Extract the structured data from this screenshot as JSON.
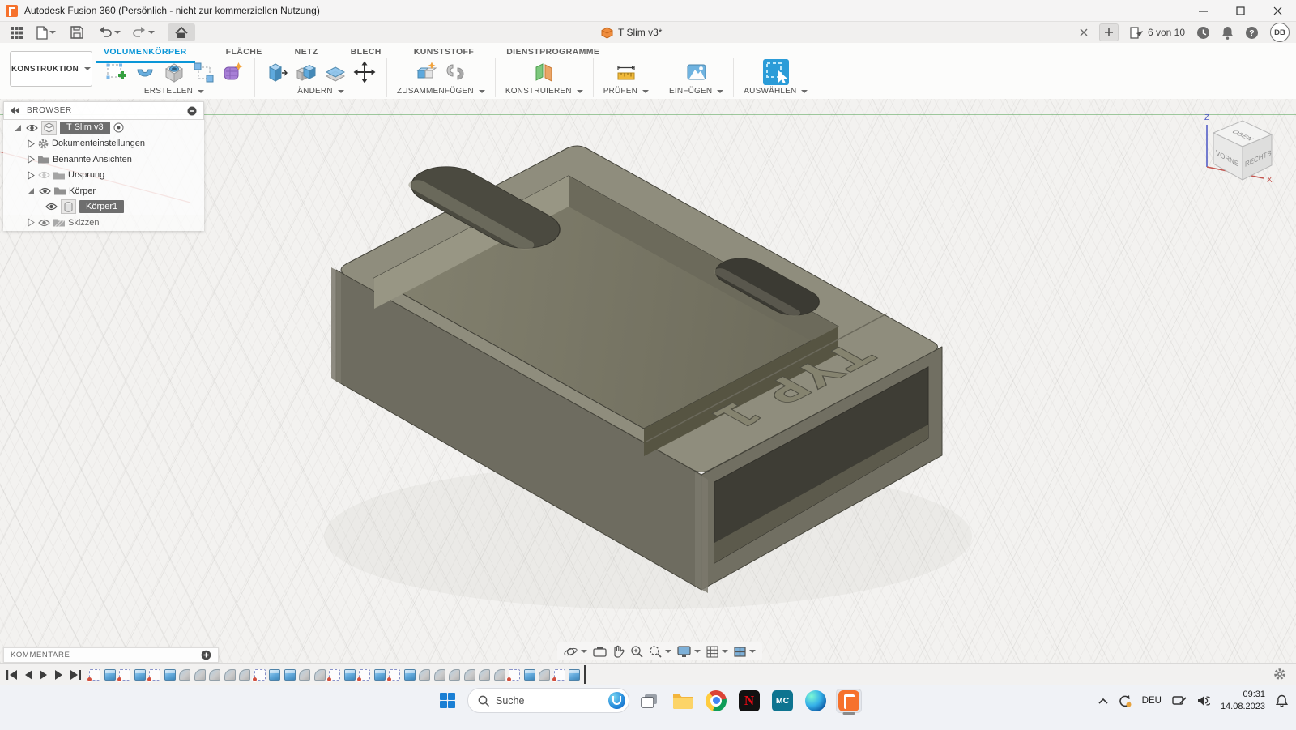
{
  "titlebar": {
    "title": "Autodesk Fusion 360 (Persönlich - nicht zur kommerziellen Nutzung)"
  },
  "document_tab": {
    "title": "T Slim v3*"
  },
  "topbar": {
    "jobs": "6 von 10",
    "help": "?",
    "avatar": "DB"
  },
  "ribbon": {
    "context": "KONSTRUKTION",
    "tabs": [
      "VOLUMENKÖRPER",
      "FLÄCHE",
      "NETZ",
      "BLECH",
      "KUNSTSTOFF",
      "DIENSTPROGRAMME"
    ],
    "groups": [
      "ERSTELLEN",
      "ÄNDERN",
      "ZUSAMMENFÜGEN",
      "KONSTRUIEREN",
      "PRÜFEN",
      "EINFÜGEN",
      "AUSWÄHLEN"
    ]
  },
  "browser": {
    "title": "BROWSER",
    "nodes": {
      "root": "T Slim v3",
      "doc_settings": "Dokumenteinstellungen",
      "named_views": "Benannte Ansichten",
      "origin": "Ursprung",
      "bodies": "Körper",
      "body1": "Körper1",
      "sketches": "Skizzen"
    }
  },
  "viewcube": {
    "top": "OBEN",
    "front": "VORNE",
    "right": "RECHTS",
    "axis_z": "Z",
    "axis_x": "X"
  },
  "model": {
    "engraving": "TYP 1"
  },
  "comments": {
    "title": "KOMMENTARE"
  },
  "timeline": {
    "features": [
      "sketch",
      "extrude",
      "sketch",
      "extrude",
      "sketch",
      "extrude",
      "fillet",
      "fillet",
      "fillet",
      "fillet",
      "fillet",
      "sketch",
      "extrude",
      "extrude",
      "fillet",
      "fillet",
      "sketch",
      "extrude",
      "sketch",
      "extrude",
      "sketch",
      "extrude",
      "fillet",
      "fillet",
      "fillet",
      "fillet",
      "fillet",
      "fillet",
      "sketch",
      "extrude",
      "fillet",
      "sketch",
      "extrude"
    ]
  },
  "taskbar": {
    "search": "Suche",
    "netflix": "N",
    "mc": "MC",
    "language": "DEU",
    "time": "09:31",
    "date": "14.08.2023"
  }
}
